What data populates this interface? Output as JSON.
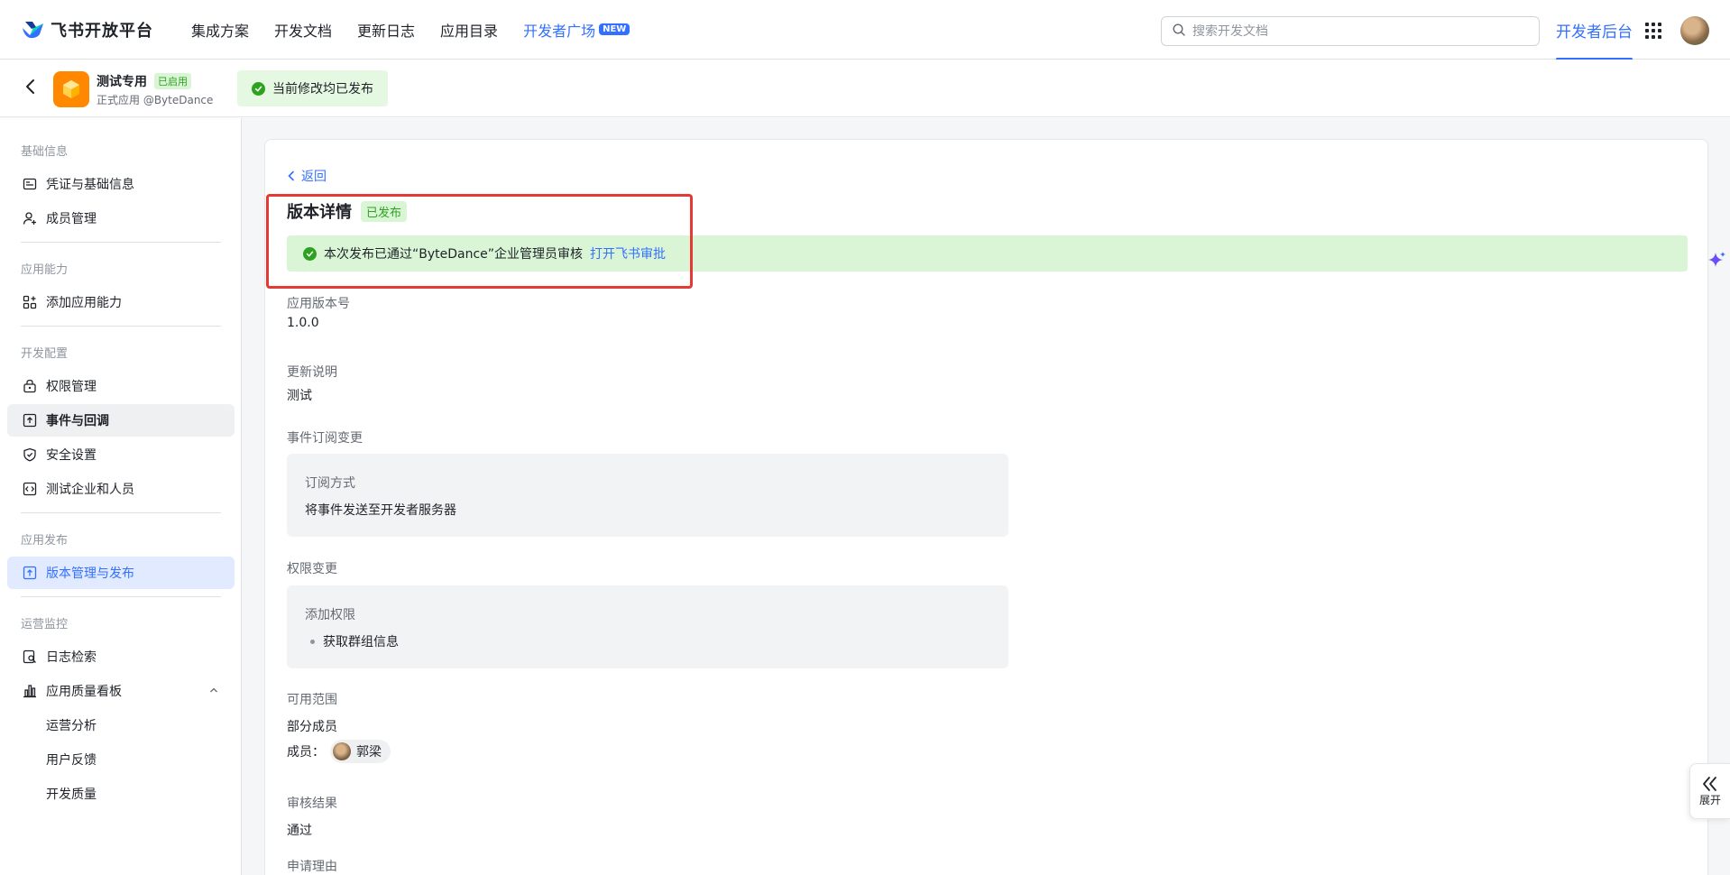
{
  "topnav": {
    "logo_text": "飞书开放平台",
    "items": [
      {
        "label": "集成方案"
      },
      {
        "label": "开发文档"
      },
      {
        "label": "更新日志"
      },
      {
        "label": "应用目录"
      },
      {
        "label": "开发者广场",
        "badge": "NEW"
      }
    ],
    "search_placeholder": "搜索开发文档",
    "dev_backend": "开发者后台"
  },
  "appbar": {
    "app_name": "测试专用",
    "status_badge": "已启用",
    "subtitle": "正式应用 @ByteDance",
    "publish_status": "当前修改均已发布"
  },
  "sidebar": {
    "groups": [
      {
        "label": "基础信息",
        "items": [
          "凭证与基础信息",
          "成员管理"
        ]
      },
      {
        "label": "应用能力",
        "items": [
          "添加应用能力"
        ]
      },
      {
        "label": "开发配置",
        "items": [
          "权限管理",
          "事件与回调",
          "安全设置",
          "测试企业和人员"
        ]
      },
      {
        "label": "应用发布",
        "items": [
          "版本管理与发布"
        ]
      },
      {
        "label": "运营监控",
        "items": [
          "日志检索",
          "应用质量看板"
        ],
        "subitems": [
          "运营分析",
          "用户反馈",
          "开发质量"
        ]
      }
    ]
  },
  "detail": {
    "back_label": "返回",
    "title": "版本详情",
    "status_tag": "已发布",
    "audit_text": "本次发布已通过“ByteDance”企业管理员审核",
    "audit_link": "打开飞书审批",
    "version_label": "应用版本号",
    "version_value": "1.0.0",
    "notes_label": "更新说明",
    "notes_value": "测试",
    "event_label": "事件订阅变更",
    "event_box_label": "订阅方式",
    "event_box_value": "将事件发送至开发者服务器",
    "perm_label": "权限变更",
    "perm_box_label": "添加权限",
    "perm_box_value": "获取群组信息",
    "scope_label": "可用范围",
    "scope_value": "部分成员",
    "member_prefix": "成员：",
    "member_name": "郭梁",
    "review_label": "审核结果",
    "review_value": "通过",
    "reason_label": "申请理由"
  },
  "float": {
    "expand_label": "展开"
  },
  "colors": {
    "accent": "#3370ff",
    "success": "#2ea121",
    "success_bg": "#d9f5d6",
    "highlight_box": "#e53935",
    "app_icon": "#ff8800"
  }
}
